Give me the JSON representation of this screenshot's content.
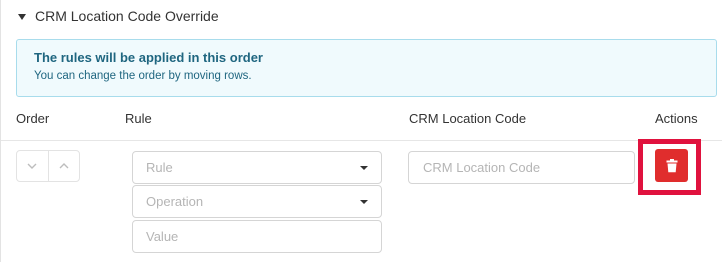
{
  "section": {
    "title": "CRM Location Code Override",
    "caret_icon": "caret-down-icon"
  },
  "info": {
    "title": "The rules will be applied in this order",
    "subtitle": "You can change the order by moving rows."
  },
  "table": {
    "headers": {
      "order": "Order",
      "rule": "Rule",
      "code": "CRM Location Code",
      "actions": "Actions"
    }
  },
  "row": {
    "move_down_icon": "chevron-down-icon",
    "move_up_icon": "chevron-up-icon",
    "rule_placeholder": "Rule",
    "operation_placeholder": "Operation",
    "value_placeholder": "Value",
    "code_placeholder": "CRM Location Code",
    "delete_icon": "trash-icon"
  },
  "colors": {
    "info_bg": "#f0fafd",
    "info_border": "#a8dcec",
    "info_text": "#1f6680",
    "delete_button": "#e02d2d",
    "highlight_outline": "#e0123e"
  }
}
